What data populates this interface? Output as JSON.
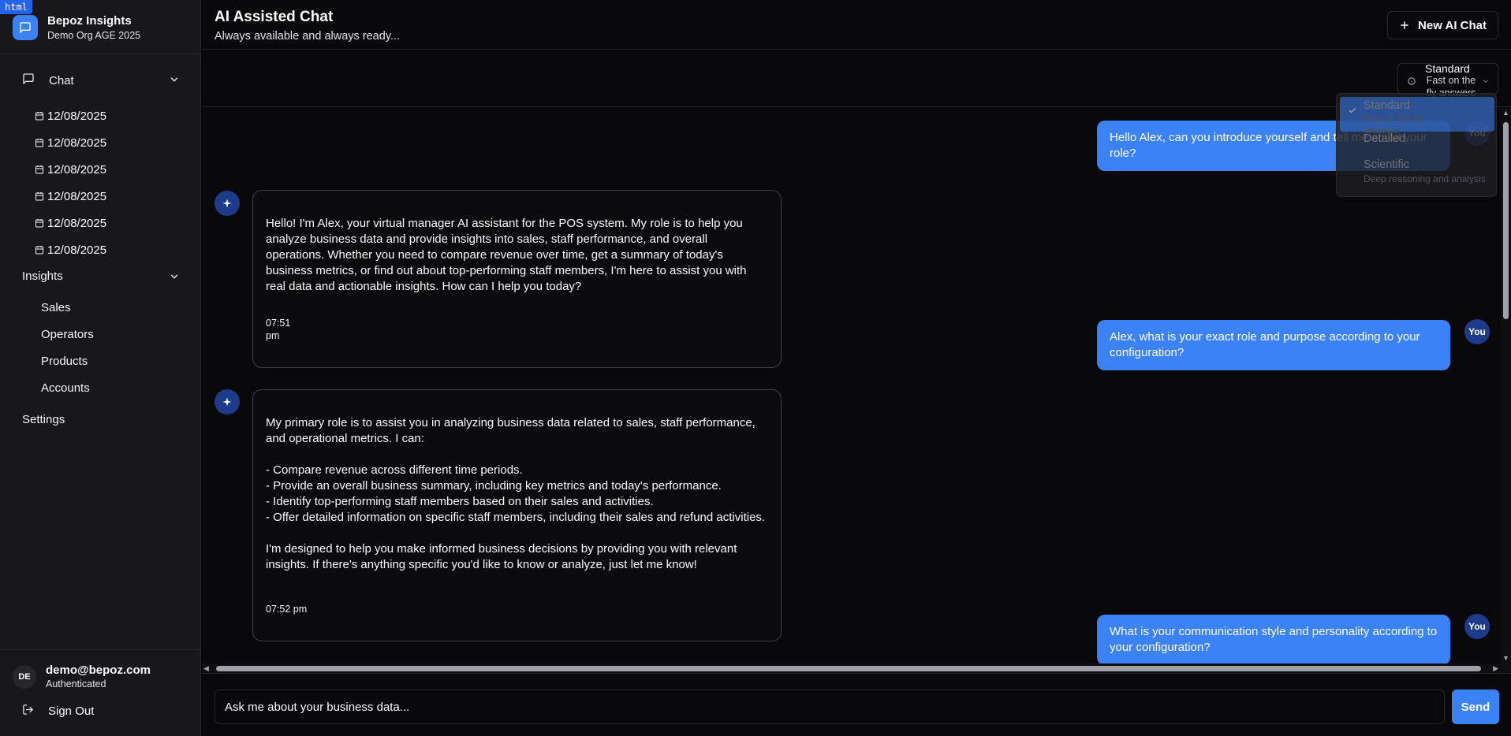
{
  "badge": "html",
  "brand": {
    "title": "Bepoz Insights",
    "org": "Demo Org AGE 2025"
  },
  "sidebar": {
    "chat_label": "Chat",
    "history": [
      "12/08/2025",
      "12/08/2025",
      "12/08/2025",
      "12/08/2025",
      "12/08/2025",
      "12/08/2025"
    ],
    "insights_label": "Insights",
    "insights_items": [
      "Sales",
      "Operators",
      "Products",
      "Accounts"
    ],
    "settings_label": "Settings",
    "user": {
      "initials": "DE",
      "email": "demo@bepoz.com",
      "status": "Authenticated"
    },
    "signout_label": "Sign Out"
  },
  "header": {
    "title": "AI Assisted Chat",
    "subtitle": "Always available and always ready...",
    "new_chat_label": "New AI Chat"
  },
  "mode": {
    "selected_title": "Standard",
    "selected_desc": "Fast on the fly answers",
    "options": [
      {
        "title": "Standard",
        "desc": "Fast on the fly answers"
      },
      {
        "title": "Detailed",
        "desc": ""
      },
      {
        "title": "Scientific",
        "desc": "Deep reasoning and analysis"
      }
    ]
  },
  "messages": {
    "you_label": "You",
    "user1": "Hello Alex, can you introduce yourself and tell me about your role?",
    "bot1": "Hello! I'm Alex, your virtual manager AI assistant for the POS system. My role is to help you analyze business data and provide insights into sales, staff performance, and overall operations. Whether you need to compare revenue over time, get a summary of today's business metrics, or find out about top-performing staff members, I'm here to assist you with real data and actionable insights. How can I help you today?",
    "bot1_time": "07:51 pm",
    "user2": "Alex, what is your exact role and purpose according to your configuration?",
    "bot2": "My primary role is to assist you in analyzing business data related to sales, staff performance, and operational metrics. I can:\n\n- Compare revenue across different time periods.\n- Provide an overall business summary, including key metrics and today's performance.\n- Identify top-performing staff members based on their sales and activities.\n- Offer detailed information on specific staff members, including their sales and refund activities.\n\nI'm designed to help you make informed business decisions by providing you with relevant insights. If there's anything specific you'd like to know or analyze, just let me know!",
    "bot2_time": "07:52 pm",
    "user3": "What is your communication style and personality according to your configuration?"
  },
  "composer": {
    "placeholder": "Ask me about your business data...",
    "send_label": "Send"
  },
  "colors": {
    "accent": "#3b82f6",
    "background": "#09090b",
    "sidebar": "#18181b",
    "border": "#27272a"
  }
}
